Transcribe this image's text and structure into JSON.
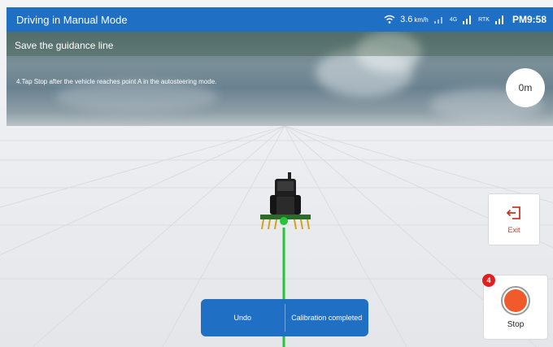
{
  "status_bar": {
    "title": "Driving in Manual Mode",
    "speed_value": "3.6",
    "speed_unit": "km/h",
    "network_label": "4G",
    "rtk_label": "RTK",
    "time": "PM9:58"
  },
  "guidance": {
    "header": "Save the guidance line",
    "instruction": "4.Tap Stop after the vehicle reaches point A in the autosteering mode.",
    "distance": "0m"
  },
  "buttons": {
    "exit_label": "Exit",
    "stop_label": "Stop",
    "stop_badge": "4",
    "undo_label": "Undo",
    "calibration_label": "Calibration completed"
  },
  "colors": {
    "brand_blue": "#1f6fc4",
    "guidance_line": "#27c33a",
    "stop_red": "#f15a2b",
    "exit_red": "#c23a2c",
    "badge_red": "#e02020"
  }
}
